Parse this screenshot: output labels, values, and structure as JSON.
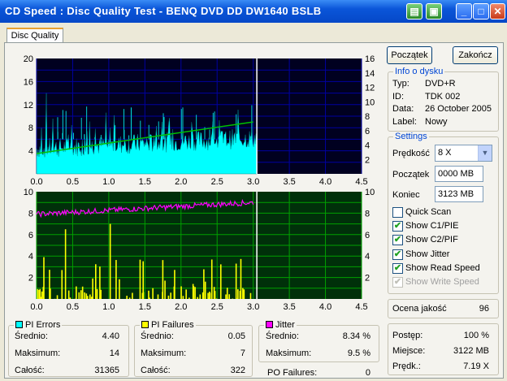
{
  "window": {
    "title": "CD Speed : Disc Quality Test - BENQ    DVD DD DW1640    BSLB"
  },
  "tab": "Disc Quality",
  "buttons": {
    "start": "Początek",
    "end": "Zakończ"
  },
  "disc_info": {
    "title": "Info o dysku",
    "rows": [
      {
        "k": "Typ:",
        "v": "DVD+R"
      },
      {
        "k": "ID:",
        "v": "TDK 002"
      },
      {
        "k": "Data:",
        "v": "26 October 2005"
      },
      {
        "k": "Label:",
        "v": "Nowy"
      }
    ]
  },
  "settings": {
    "title": "Settings",
    "speed_label": "Prędkość",
    "speed_value": "8 X",
    "start_label": "Początek",
    "start_value": "0000 MB",
    "end_label": "Koniec",
    "end_value": "3123 MB",
    "checks": [
      {
        "label": "Quick Scan",
        "checked": false
      },
      {
        "label": "Show C1/PIE",
        "checked": true
      },
      {
        "label": "Show C2/PIF",
        "checked": true
      },
      {
        "label": "Show Jitter",
        "checked": true
      },
      {
        "label": "Show Read Speed",
        "checked": true
      },
      {
        "label": "Show Write Speed",
        "checked": true,
        "disabled": true
      }
    ]
  },
  "quality": {
    "label": "Ocena jakość",
    "value": "96"
  },
  "progress": {
    "rows": [
      {
        "k": "Postęp:",
        "v": "100 %"
      },
      {
        "k": "Miejsce:",
        "v": "3122 MB"
      },
      {
        "k": "Prędk.:",
        "v": "7.19 X"
      }
    ]
  },
  "pi_errors": {
    "title": "PI Errors",
    "color": "#00ffff",
    "rows": [
      {
        "k": "Średnio:",
        "v": "4.40"
      },
      {
        "k": "Maksimum:",
        "v": "14"
      },
      {
        "k": "Całość:",
        "v": "31365"
      }
    ]
  },
  "pi_failures": {
    "title": "PI Failures",
    "color": "#ffff00",
    "rows": [
      {
        "k": "Średnio:",
        "v": "0.05"
      },
      {
        "k": "Maksimum:",
        "v": "7"
      },
      {
        "k": "Całość:",
        "v": "322"
      }
    ]
  },
  "jitter": {
    "title": "Jitter",
    "color": "#ff00ff",
    "rows": [
      {
        "k": "Średnio:",
        "v": "8.34 %"
      },
      {
        "k": "Maksimum:",
        "v": "9.5 %"
      }
    ]
  },
  "po_failures": {
    "label": "PO Failures:",
    "value": "0"
  },
  "chart_data": [
    {
      "type": "area",
      "x_ticks": [
        "0.0",
        "0.5",
        "1.0",
        "1.5",
        "2.0",
        "2.5",
        "3.0",
        "3.5",
        "4.0",
        "4.5"
      ],
      "y_left_ticks": [
        "20",
        "16",
        "12",
        "8",
        "4"
      ],
      "y_right_ticks": [
        "16",
        "14",
        "12",
        "10",
        "8",
        "6",
        "4",
        "2"
      ],
      "xlim": [
        0,
        4.5
      ],
      "ylim": [
        0,
        20
      ],
      "y2lim": [
        0,
        16
      ],
      "series": [
        {
          "name": "PI Errors",
          "color": "#00ffff",
          "x_end": 3.05,
          "mean": 4.4,
          "max": 14
        },
        {
          "name": "Read Speed",
          "color": "#00c000",
          "x": [
            0,
            3.0
          ],
          "y": [
            2.8,
            7.2
          ]
        }
      ],
      "marker_x": 3.05
    },
    {
      "type": "bar",
      "x_ticks": [
        "0.0",
        "0.5",
        "1.0",
        "1.5",
        "2.0",
        "2.5",
        "3.0",
        "3.5",
        "4.0",
        "4.5"
      ],
      "y_left_ticks": [
        "10",
        "8",
        "6",
        "4",
        "2"
      ],
      "y_right_ticks": [
        "10",
        "8",
        "6",
        "4",
        "2"
      ],
      "xlim": [
        0,
        4.5
      ],
      "ylim": [
        0,
        10
      ],
      "series": [
        {
          "name": "PI Failures",
          "color": "#ffff00",
          "max": 7
        },
        {
          "name": "Jitter",
          "color": "#ff00ff",
          "x": [
            0,
            3.0
          ],
          "y": [
            7.9,
            9.0
          ]
        }
      ],
      "marker_x": 3.05
    }
  ]
}
